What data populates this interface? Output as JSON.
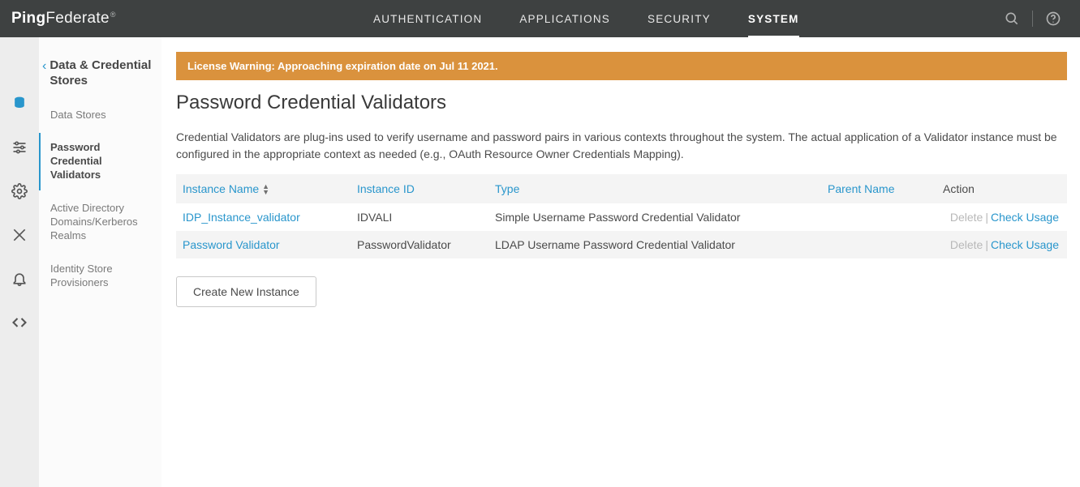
{
  "brand": {
    "ping": "Ping",
    "federate": "Federate"
  },
  "topnav": {
    "items": [
      "AUTHENTICATION",
      "APPLICATIONS",
      "SECURITY",
      "SYSTEM"
    ],
    "active_index": 3
  },
  "topright_icons": [
    "search-icon",
    "help-icon"
  ],
  "iconrail": {
    "icons": [
      "database-icon",
      "sliders-icon",
      "gear-icon",
      "tools-icon",
      "bell-icon",
      "code-icon"
    ],
    "active_index": 0
  },
  "sidebar": {
    "title": "Data & Credential Stores",
    "items": [
      {
        "label": "Data Stores",
        "active": false
      },
      {
        "label": "Password Credential Validators",
        "active": true
      },
      {
        "label": "Active Directory Domains/Kerberos Realms",
        "active": false
      },
      {
        "label": "Identity Store Provisioners",
        "active": false
      }
    ]
  },
  "warning": "License Warning: Approaching expiration date on Jul 11 2021.",
  "page": {
    "title": "Password Credential Validators",
    "description": "Credential Validators are plug-ins used to verify username and password pairs in various contexts throughout the system. The actual application of a Validator instance must be configured in the appropriate context as needed (e.g., OAuth Resource Owner Credentials Mapping)."
  },
  "table": {
    "headers": {
      "name": "Instance Name",
      "id": "Instance ID",
      "type": "Type",
      "parent": "Parent Name",
      "action": "Action"
    },
    "actions": {
      "delete": "Delete",
      "check": "Check Usage"
    },
    "rows": [
      {
        "name": "IDP_Instance_validator",
        "id": "IDVALI",
        "type": "Simple Username Password Credential Validator",
        "parent": ""
      },
      {
        "name": "Password Validator",
        "id": "PasswordValidator",
        "type": "LDAP Username Password Credential Validator",
        "parent": ""
      }
    ]
  },
  "buttons": {
    "create": "Create New Instance"
  }
}
